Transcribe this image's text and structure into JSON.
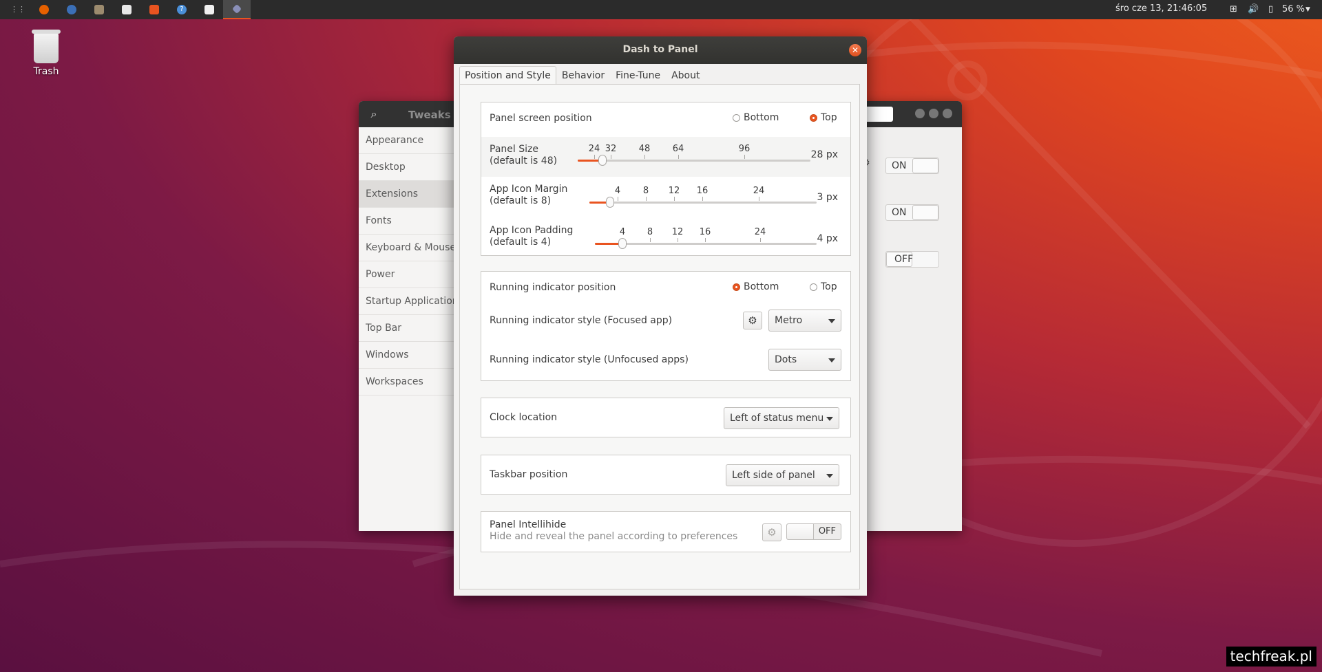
{
  "topbar": {
    "clock": "śro cze 13, 21:46:05",
    "battery": "56 %",
    "launcher_icons": [
      "apps-grid-icon",
      "firefox-icon",
      "thunderbird-icon",
      "files-icon",
      "libreoffice-icon",
      "software-center-icon",
      "help-icon",
      "text-editor-icon",
      "tweaks-icon"
    ]
  },
  "desktop": {
    "trash_label": "Trash"
  },
  "tweaks": {
    "title": "Tweaks",
    "sidebar": [
      {
        "label": "Appearance"
      },
      {
        "label": "Desktop"
      },
      {
        "label": "Extensions",
        "selected": true
      },
      {
        "label": "Fonts"
      },
      {
        "label": "Keyboard & Mouse"
      },
      {
        "label": "Power"
      },
      {
        "label": "Startup Applications"
      },
      {
        "label": "Top Bar"
      },
      {
        "label": "Windows"
      },
      {
        "label": "Workspaces"
      }
    ],
    "switches": [
      "ON",
      "ON",
      "OFF"
    ]
  },
  "dialog": {
    "title": "Dash to Panel",
    "tabs": [
      "Position and Style",
      "Behavior",
      "Fine-Tune",
      "About"
    ],
    "panel_position": {
      "label": "Panel screen position",
      "options": [
        "Bottom",
        "Top"
      ],
      "selected": "Top"
    },
    "panel_size": {
      "label": "Panel Size",
      "default": "(default is 48)",
      "marks": [
        "24",
        "32",
        "48",
        "64",
        "96"
      ],
      "value": "28 px"
    },
    "icon_margin": {
      "label": "App Icon Margin",
      "default": "(default is 8)",
      "marks": [
        "4",
        "8",
        "12",
        "16",
        "24"
      ],
      "value": "3 px"
    },
    "icon_padding": {
      "label": "App Icon Padding",
      "default": "(default is 4)",
      "marks": [
        "4",
        "8",
        "12",
        "16",
        "24"
      ],
      "value": "4 px"
    },
    "indicator_position": {
      "label": "Running indicator position",
      "options": [
        "Bottom",
        "Top"
      ],
      "selected": "Bottom"
    },
    "indicator_focused": {
      "label": "Running indicator style (Focused app)",
      "value": "Metro"
    },
    "indicator_unfocused": {
      "label": "Running indicator style (Unfocused apps)",
      "value": "Dots"
    },
    "clock_location": {
      "label": "Clock location",
      "value": "Left of status menu"
    },
    "taskbar_position": {
      "label": "Taskbar position",
      "value": "Left side of panel"
    },
    "intellihide": {
      "label": "Panel Intellihide",
      "description": "Hide and reveal the panel according to preferences",
      "state": "OFF"
    }
  },
  "watermark": "techfreak.pl",
  "colors": {
    "accent": "#e95420",
    "panel": "#2b2b2b",
    "titlebar": "#3a3a37"
  }
}
